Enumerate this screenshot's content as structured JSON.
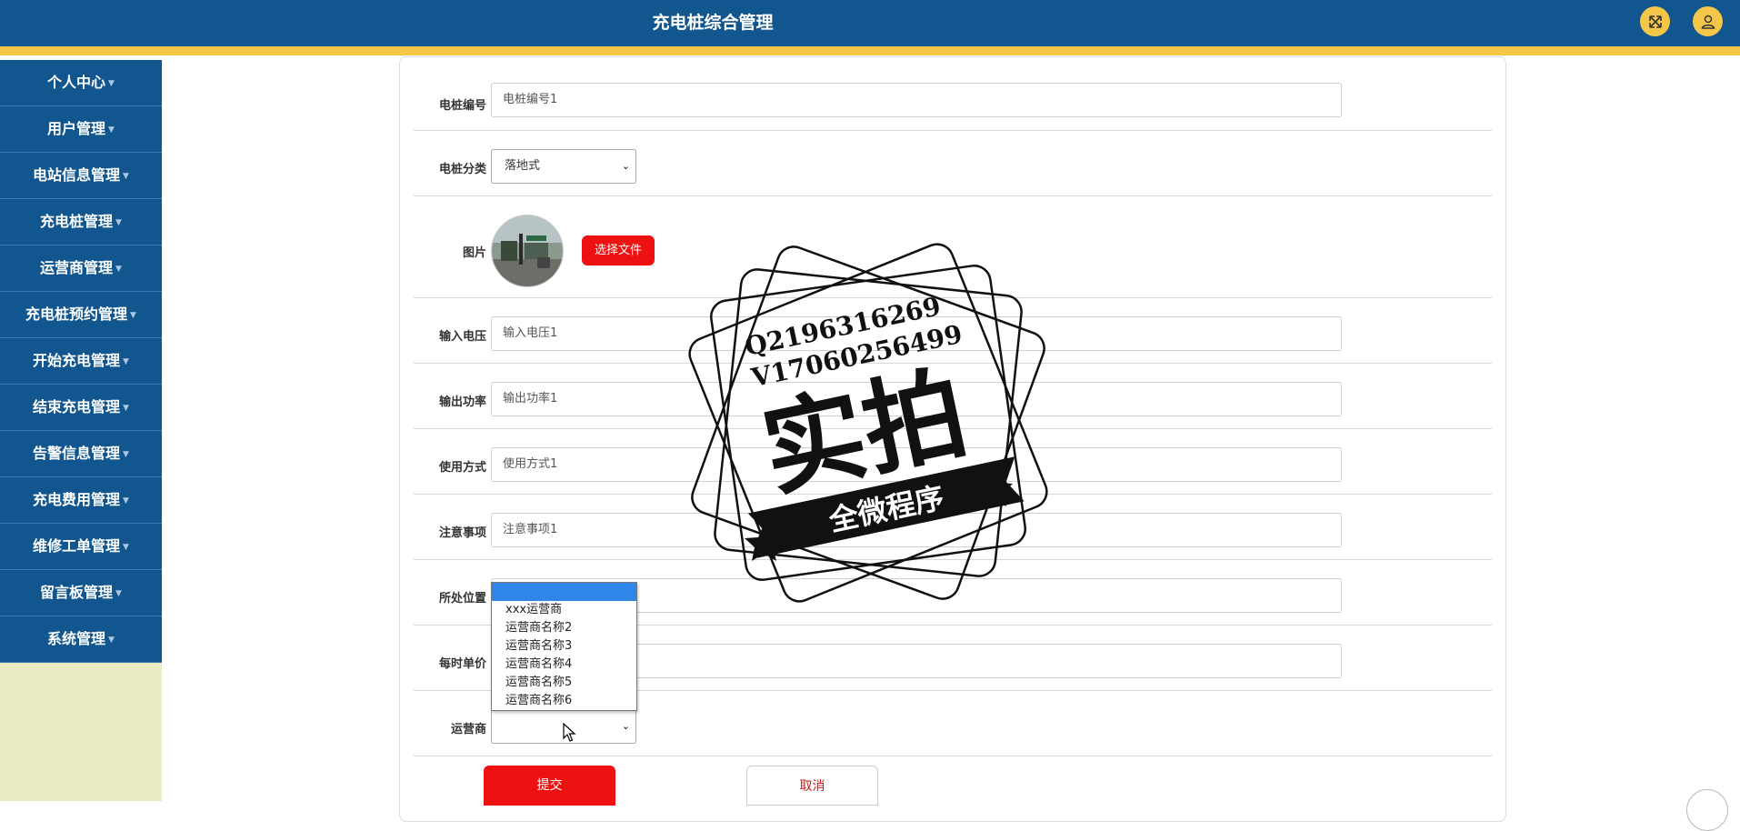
{
  "header": {
    "title": "充电桩综合管理",
    "icons": [
      "fullscreen-icon",
      "user-icon"
    ],
    "bg_color": "#12568f",
    "accent_color": "#f5c748"
  },
  "sidebar": {
    "items": [
      {
        "label": "个人中心"
      },
      {
        "label": "用户管理"
      },
      {
        "label": "电站信息管理"
      },
      {
        "label": "充电桩管理"
      },
      {
        "label": "运营商管理"
      },
      {
        "label": "充电桩预约管理"
      },
      {
        "label": "开始充电管理"
      },
      {
        "label": "结束充电管理"
      },
      {
        "label": "告警信息管理"
      },
      {
        "label": "充电费用管理"
      },
      {
        "label": "维修工单管理"
      },
      {
        "label": "留言板管理"
      },
      {
        "label": "系统管理"
      }
    ]
  },
  "form": {
    "pile_number": {
      "label": "电桩编号",
      "value": "电桩编号1"
    },
    "pile_category": {
      "label": "电桩分类",
      "value": "落地式"
    },
    "image": {
      "label": "图片",
      "button": "选择文件"
    },
    "input_voltage": {
      "label": "输入电压",
      "value": "输入电压1"
    },
    "output_power": {
      "label": "输出功率",
      "value": "输出功率1"
    },
    "usage": {
      "label": "使用方式",
      "value": "使用方式1"
    },
    "notes": {
      "label": "注意事项",
      "value": "注意事项1"
    },
    "location": {
      "label": "所处位置",
      "value": ""
    },
    "hourly_price": {
      "label": "每时单价",
      "value": ""
    },
    "operator": {
      "label": "运营商",
      "value": "",
      "options": [
        "",
        "xxx运营商",
        "运营商名称2",
        "运营商名称3",
        "运营商名称4",
        "运营商名称5",
        "运营商名称6"
      ]
    },
    "submit_label": "提交",
    "cancel_label": "取消"
  },
  "watermark": {
    "line1": "Q2196316269",
    "line2": "V17060256499",
    "big": "实拍",
    "banner": "全微程序"
  }
}
